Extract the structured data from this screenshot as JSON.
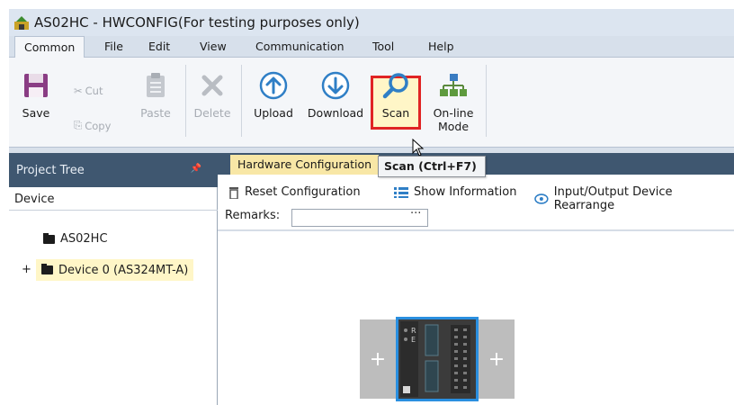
{
  "window": {
    "title": "AS02HC - HWCONFIG(For testing purposes only)"
  },
  "menu": {
    "tabs": [
      "Common",
      "File",
      "Edit",
      "View",
      "Communication",
      "Tool",
      "Help"
    ],
    "active": "Common"
  },
  "ribbon": {
    "save": "Save",
    "cut": "Cut",
    "copy": "Copy",
    "paste": "Paste",
    "delete": "Delete",
    "upload": "Upload",
    "download": "Download",
    "scan": "Scan",
    "online_mode_line1": "On-line",
    "online_mode_line2": "Mode"
  },
  "tooltip": {
    "text": "Scan (Ctrl+F7)"
  },
  "project_tree": {
    "title": "Project Tree",
    "column": "Device",
    "items": [
      {
        "label": "AS02HC",
        "expander": ""
      },
      {
        "label": "Device 0 (AS324MT-A)",
        "expander": "+"
      }
    ]
  },
  "document": {
    "tab": "Hardware Configuration",
    "toolbar": {
      "reset": "Reset Configuration",
      "show_info": "Show Information",
      "rearrange": "Input/Output Device Rearrange"
    },
    "remarks_label": "Remarks:",
    "remarks_value": "",
    "remarks_button": "···"
  },
  "canvas": {
    "slot_left": "+",
    "slot_right": "+",
    "module_leds": [
      "R",
      "E"
    ]
  },
  "colors": {
    "panel_header": "#3f5770",
    "highlight_border": "#e02424",
    "selection": "#fff6c7",
    "module_selection": "#2a8fe0",
    "doc_tab": "#f8e7a6"
  },
  "icons": {
    "save": "floppy-disk-icon",
    "cut": "scissors-icon",
    "copy": "copy-icon",
    "paste": "clipboard-icon",
    "delete": "x-icon",
    "upload": "arrow-up-circle-icon",
    "download": "arrow-down-circle-icon",
    "scan": "magnifier-icon",
    "online": "network-icon"
  }
}
